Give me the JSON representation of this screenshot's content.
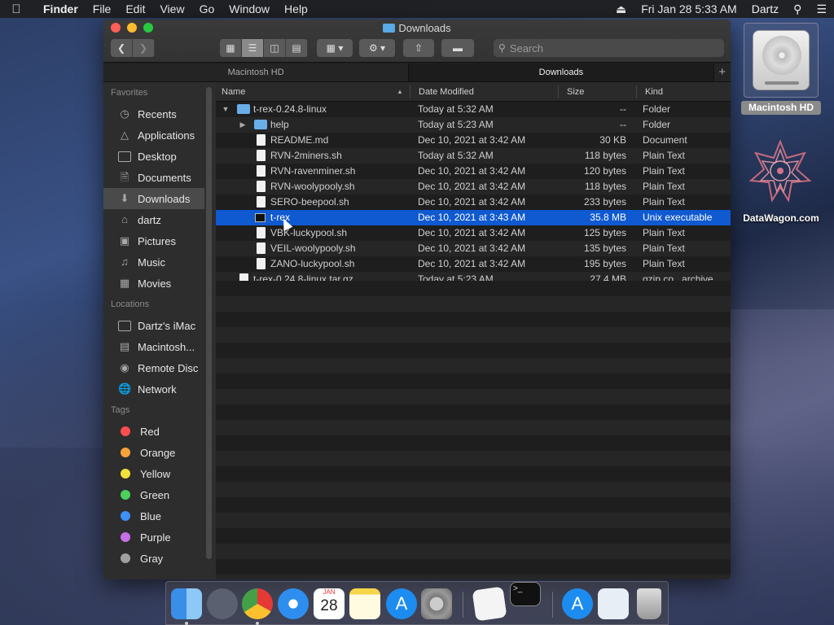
{
  "menubar": {
    "app_name": "Finder",
    "items": [
      "File",
      "Edit",
      "View",
      "Go",
      "Window",
      "Help"
    ],
    "datetime": "Fri Jan 28  5:33 AM",
    "user": "Dartz"
  },
  "window": {
    "title": "Downloads",
    "search_placeholder": "Search",
    "tabs": [
      "Macintosh HD",
      "Downloads"
    ],
    "active_tab": "Downloads"
  },
  "sidebar": {
    "favorites_heading": "Favorites",
    "favorites": [
      "Recents",
      "Applications",
      "Desktop",
      "Documents",
      "Downloads",
      "dartz",
      "Pictures",
      "Music",
      "Movies"
    ],
    "selected": "Downloads",
    "locations_heading": "Locations",
    "locations": [
      "Dartz's iMac",
      "Macintosh...",
      "Remote Disc",
      "Network"
    ],
    "tags_heading": "Tags",
    "tags": [
      {
        "name": "Red",
        "color": "#fb4e4e"
      },
      {
        "name": "Orange",
        "color": "#f6a23a"
      },
      {
        "name": "Yellow",
        "color": "#f3e03b"
      },
      {
        "name": "Green",
        "color": "#4cd05a"
      },
      {
        "name": "Blue",
        "color": "#3f8ff6"
      },
      {
        "name": "Purple",
        "color": "#c66fe6"
      },
      {
        "name": "Gray",
        "color": "#a0a0a0"
      }
    ]
  },
  "columns": {
    "name": "Name",
    "date": "Date Modified",
    "size": "Size",
    "kind": "Kind"
  },
  "files": [
    {
      "name": "t-rex-0.24.8-linux",
      "date": "Today at 5:32 AM",
      "size": "--",
      "kind": "Folder"
    },
    {
      "name": "help",
      "date": "Today at 5:23 AM",
      "size": "--",
      "kind": "Folder"
    },
    {
      "name": "README.md",
      "date": "Dec 10, 2021 at 3:42 AM",
      "size": "30 KB",
      "kind": "Document"
    },
    {
      "name": "RVN-2miners.sh",
      "date": "Today at 5:32 AM",
      "size": "118 bytes",
      "kind": "Plain Text"
    },
    {
      "name": "RVN-ravenminer.sh",
      "date": "Dec 10, 2021 at 3:42 AM",
      "size": "120 bytes",
      "kind": "Plain Text"
    },
    {
      "name": "RVN-woolypooly.sh",
      "date": "Dec 10, 2021 at 3:42 AM",
      "size": "118 bytes",
      "kind": "Plain Text"
    },
    {
      "name": "SERO-beepool.sh",
      "date": "Dec 10, 2021 at 3:42 AM",
      "size": "233 bytes",
      "kind": "Plain Text"
    },
    {
      "name": "t-rex",
      "date": "Dec 10, 2021 at 3:43 AM",
      "size": "35.8 MB",
      "kind": "Unix executable"
    },
    {
      "name": "VBK-luckypool.sh",
      "date": "Dec 10, 2021 at 3:42 AM",
      "size": "125 bytes",
      "kind": "Plain Text"
    },
    {
      "name": "VEIL-woolypooly.sh",
      "date": "Dec 10, 2021 at 3:42 AM",
      "size": "135 bytes",
      "kind": "Plain Text"
    },
    {
      "name": "ZANO-luckypool.sh",
      "date": "Dec 10, 2021 at 3:42 AM",
      "size": "195 bytes",
      "kind": "Plain Text"
    },
    {
      "name": "t-rex-0.24.8-linux.tar.gz",
      "date": "Today at 5:23 AM",
      "size": "27.4 MB",
      "kind": "gzip co...archive"
    }
  ],
  "desktop": {
    "hd_label": "Macintosh HD",
    "site_label": "DataWagon.com"
  },
  "dock": {
    "calendar_month": "JAN",
    "calendar_day": "28",
    "terminal_prompt": ">_"
  },
  "colors": {
    "selection": "#0f59d1",
    "folder": "#6aaee8"
  }
}
